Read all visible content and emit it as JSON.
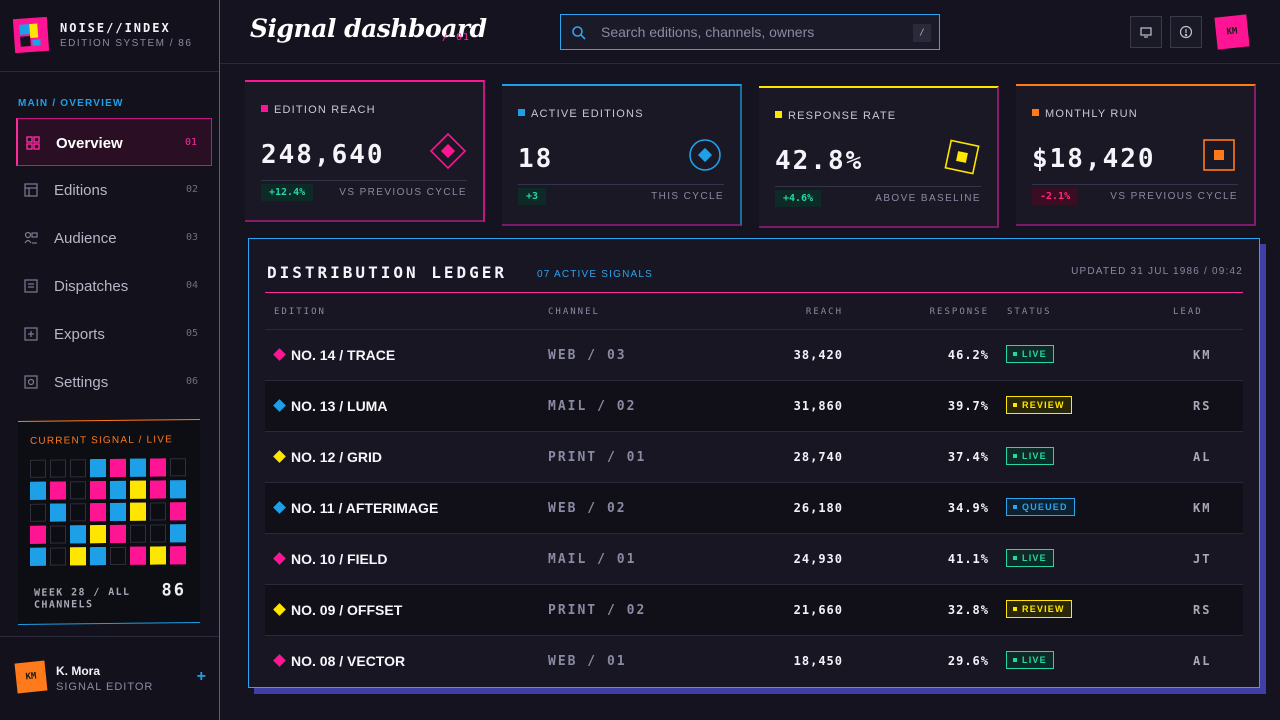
{
  "brand": {
    "name": "NOISE//INDEX",
    "subtitle": "EDITION SYSTEM / 86"
  },
  "nav": {
    "section": "MAIN / OVERVIEW",
    "items": [
      {
        "label": "Overview",
        "num": "01",
        "icon": "grid-icon",
        "active": true
      },
      {
        "label": "Editions",
        "num": "02",
        "icon": "layout-icon"
      },
      {
        "label": "Audience",
        "num": "03",
        "icon": "users-icon"
      },
      {
        "label": "Dispatches",
        "num": "04",
        "icon": "inbox-icon"
      },
      {
        "label": "Exports",
        "num": "05",
        "icon": "plus-square-icon"
      },
      {
        "label": "Settings",
        "num": "06",
        "icon": "settings-icon"
      }
    ]
  },
  "signal": {
    "title": "CURRENT SIGNAL / LIVE",
    "week": "WEEK 28 / ALL CHANNELS",
    "number": "86",
    "cells": "eeeckcke cmekcxkc eceknxek mecxkeec cexcekxk"
  },
  "user": {
    "initials": "KM",
    "name": "K. Mora",
    "role": "SIGNAL EDITOR",
    "add": "+"
  },
  "header": {
    "title": "Signal dashboard",
    "sub": "/ 01",
    "search_placeholder": "Search editions, channels, owners",
    "search_shortcut": "/",
    "avatar": "KM"
  },
  "metrics": [
    {
      "label": "EDITION REACH",
      "value": "248,640",
      "badge": "+12.4%",
      "note": "VS PREVIOUS CYCLE",
      "color": "#ff1493"
    },
    {
      "label": "ACTIVE EDITIONS",
      "value": "18",
      "badge": "+3",
      "note": "THIS CYCLE",
      "color": "#1ea0e8"
    },
    {
      "label": "RESPONSE RATE",
      "value": "42.8%",
      "badge": "+4.6%",
      "note": "ABOVE BASELINE",
      "color": "#ffe600"
    },
    {
      "label": "MONTHLY RUN",
      "value": "$18,420",
      "badge": "-2.1%",
      "note": "VS PREVIOUS CYCLE",
      "color": "#ff7a1a"
    }
  ],
  "ledger": {
    "title": "DISTRIBUTION LEDGER",
    "badge": "07 ACTIVE SIGNALS",
    "updated": "UPDATED 31 JUL 1986 / 09:42",
    "headers": [
      "EDITION",
      "CHANNEL",
      "REACH",
      "RESPONSE",
      "STATUS",
      "LEAD"
    ],
    "rows": [
      {
        "edition": "NO. 14 / TRACE",
        "channel": "WEB / 03",
        "reach": "38,420",
        "response": "46.2%",
        "status": "LIVE",
        "lead": "KM",
        "color": "#ff1493"
      },
      {
        "edition": "NO. 13 / LUMA",
        "channel": "MAIL / 02",
        "reach": "31,860",
        "response": "39.7%",
        "status": "REVIEW",
        "lead": "RS",
        "color": "#1ea0e8"
      },
      {
        "edition": "NO. 12 / GRID",
        "channel": "PRINT / 01",
        "reach": "28,740",
        "response": "37.4%",
        "status": "LIVE",
        "lead": "AL",
        "color": "#ffe600"
      },
      {
        "edition": "NO. 11 / AFTERIMAGE",
        "channel": "WEB / 02",
        "reach": "26,180",
        "response": "34.9%",
        "status": "QUEUED",
        "lead": "KM",
        "color": "#1ea0e8"
      },
      {
        "edition": "NO. 10 / FIELD",
        "channel": "MAIL / 01",
        "reach": "24,930",
        "response": "41.1%",
        "status": "LIVE",
        "lead": "JT",
        "color": "#ff1493"
      },
      {
        "edition": "NO. 09 / OFFSET",
        "channel": "PRINT / 02",
        "reach": "21,660",
        "response": "32.8%",
        "status": "REVIEW",
        "lead": "RS",
        "color": "#ffe600"
      },
      {
        "edition": "NO. 08 / VECTOR",
        "channel": "WEB / 01",
        "reach": "18,450",
        "response": "29.6%",
        "status": "LIVE",
        "lead": "AL",
        "color": "#ff1493"
      }
    ]
  },
  "status_colors": {
    "LIVE": {
      "fg": "#27d6a8",
      "bg": "#0d2a26"
    },
    "REVIEW": {
      "fg": "#ffe600",
      "bg": "#2a2608"
    },
    "QUEUED": {
      "fg": "#2aa5ef",
      "bg": "#0c2132"
    }
  }
}
